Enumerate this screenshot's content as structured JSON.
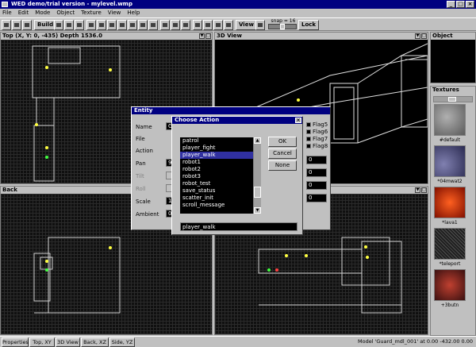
{
  "window": {
    "title": "WED demo/trial version - mylevel.wmp"
  },
  "menu": [
    "File",
    "Edit",
    "Mode",
    "Object",
    "Texture",
    "View",
    "Help"
  ],
  "toolbar": {
    "build": "Build",
    "view": "View",
    "lock": "Lock",
    "snap": "snap = 16"
  },
  "panes": {
    "top": "Top (X, Y: 0, -435) Depth 1536.0",
    "view3d": "3D View",
    "back": "Back",
    "side": "",
    "object": "Object",
    "textures": "Textures"
  },
  "entity": {
    "title": "Entity",
    "labels": [
      "Name",
      "File",
      "Action",
      "Pan",
      "Tilt",
      "Roll",
      "Scale",
      "Ambient"
    ],
    "values": {
      "name": "G",
      "pan": "9",
      "scale": "1",
      "ambient": "0"
    },
    "flags": [
      "Flag5",
      "Flag6",
      "Flag7",
      "Flag8"
    ],
    "numfields": [
      "0",
      "0",
      "0",
      "0"
    ]
  },
  "choose_action": {
    "title": "Choose Action",
    "items": [
      "patrol",
      "player_fight",
      "player_walk",
      "robot1",
      "robot2",
      "robot3",
      "robot_test",
      "save_status",
      "scatter_init",
      "scroll_message"
    ],
    "selected_index": 2,
    "selected_value": "player_walk",
    "ok": "OK",
    "cancel": "Cancel",
    "none": "None"
  },
  "textures": [
    {
      "name": "#default",
      "color": "#8a8a8a"
    },
    {
      "name": "*04mwat2",
      "color": "#4a4a7a"
    },
    {
      "name": "*lava1",
      "color": "#b02000"
    },
    {
      "name": "*teleport",
      "color": "#303030"
    },
    {
      "name": "+3butn",
      "color": "#7a2a20"
    }
  ],
  "statusbar": {
    "buttons": [
      "Properties",
      "Top, XY",
      "3D View",
      "Back, XZ",
      "Side, YZ"
    ],
    "text": "Model 'Guard_mdl_001' at 0.00 -432.00 0.00"
  }
}
